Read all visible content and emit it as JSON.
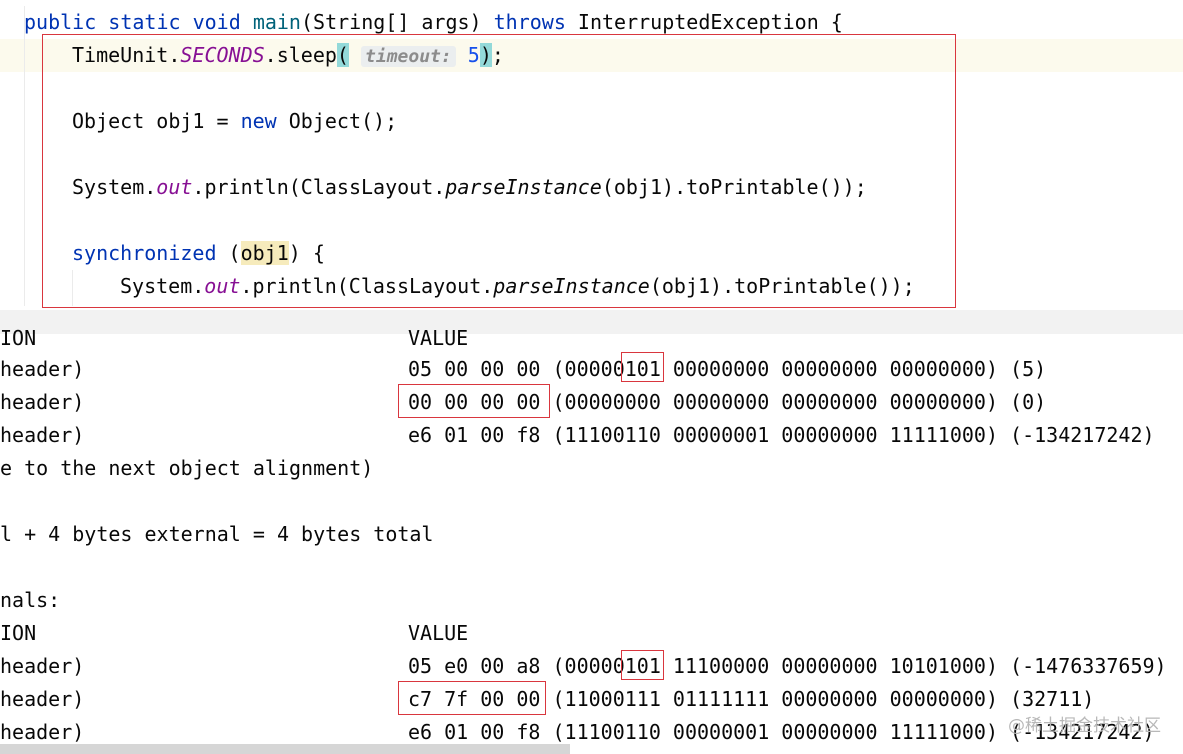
{
  "editor": {
    "line1": {
      "public": "public",
      "static": "static",
      "void": "void",
      "main": "main",
      "params": "(String[] args) ",
      "throws": "throws",
      "exception": " InterruptedException {"
    },
    "line2": {
      "prefix": "TimeUnit.",
      "seconds": "SECONDS",
      "sleep": ".sleep",
      "open": "(",
      "hint": "timeout:",
      "value": "5",
      "close": ")",
      "end": ";"
    },
    "line3": {
      "prefix": "Object obj1 = ",
      "new": "new",
      "suffix": " Object();"
    },
    "line4": {
      "system": "System.",
      "out": "out",
      "println": ".println(ClassLayout.",
      "parse": "parseInstance",
      "suffix": "(obj1).toPrintable());"
    },
    "line5": {
      "sync": "synchronized",
      "open": " (",
      "var": "obj1",
      "close": ") {"
    },
    "line6": {
      "system": "System.",
      "out": "out",
      "println": ".println(ClassLayout.",
      "parse": "parseInstance",
      "suffix": "(obj1).toPrintable());"
    }
  },
  "console": {
    "lines": [
      {
        "left": "ION",
        "right": "VALUE"
      },
      {
        "left": "header)",
        "right": "05 00 00 00 (00000101 00000000 00000000 00000000) (5)"
      },
      {
        "left": "header)",
        "right": "00 00 00 00 (00000000 00000000 00000000 00000000) (0)"
      },
      {
        "left": "header)",
        "right": "e6 01 00 f8 (11100110 00000001 00000000 11111000) (-134217242)"
      },
      {
        "left": "e to the next object alignment)",
        "right": ""
      },
      {
        "left": "",
        "right": ""
      },
      {
        "left": "l + 4 bytes external = 4 bytes total",
        "right": ""
      },
      {
        "left": "",
        "right": ""
      },
      {
        "left": "nals:",
        "right": ""
      },
      {
        "left": "ION",
        "right": "VALUE"
      },
      {
        "left": "header)",
        "right": "05 e0 00 a8 (00000101 11100000 00000000 10101000) (-1476337659)"
      },
      {
        "left": "header)",
        "right": "c7 7f 00 00 (11000111 01111111 00000000 00000000) (32711)"
      },
      {
        "left": "header)",
        "right": "e6 01 00 f8 (11100110 00000001 00000000 11111000) (-134217242)"
      }
    ]
  },
  "watermark": "@稀土掘金技术社区"
}
